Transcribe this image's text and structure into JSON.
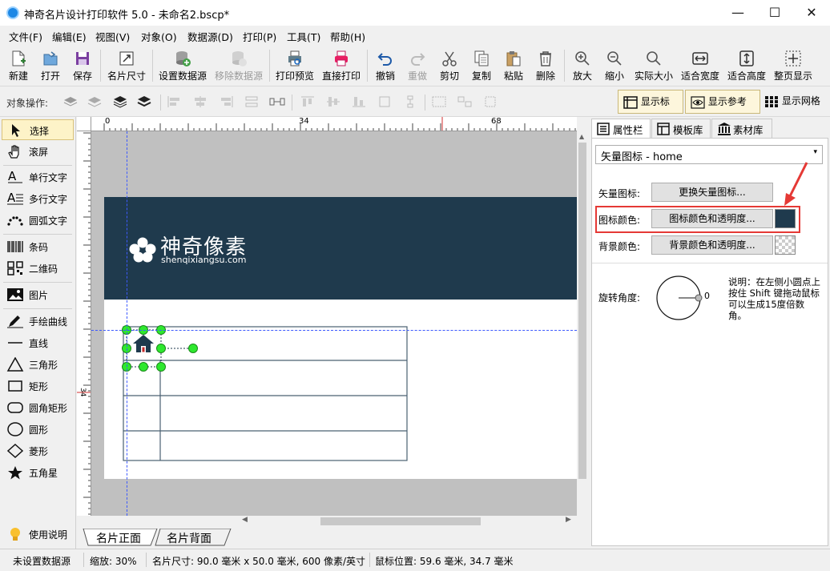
{
  "window": {
    "title": "神奇名片设计打印软件 5.0 - 未命名2.bscp*"
  },
  "menu": [
    "文件(F)",
    "编辑(E)",
    "视图(V)",
    "对象(O)",
    "数据源(D)",
    "打印(P)",
    "工具(T)",
    "帮助(H)"
  ],
  "toolbar": {
    "new": "新建",
    "open": "打开",
    "save": "保存",
    "card_size": "名片尺寸",
    "set_datasource": "设置数据源",
    "remove_datasource": "移除数据源",
    "print_preview": "打印预览",
    "direct_print": "直接打印",
    "undo": "撤销",
    "redo": "重做",
    "cut": "剪切",
    "copy": "复制",
    "paste": "粘贴",
    "delete": "删除",
    "zoom_in": "放大",
    "zoom_out": "缩小",
    "actual_size": "实际大小",
    "fit_width": "适合宽度",
    "fit_height": "适合高度",
    "fit_page": "整页显示"
  },
  "alignbar": {
    "label": "对象操作:",
    "show_ruler": "显示标尺",
    "show_guides": "显示参考线",
    "show_grid": "显示网格"
  },
  "tools": {
    "select": "选择",
    "pan": "滚屏",
    "single_text": "单行文字",
    "multi_text": "多行文字",
    "arc_text": "圆弧文字",
    "barcode": "条码",
    "qrcode": "二维码",
    "image": "图片",
    "freehand": "手绘曲线",
    "line": "直线",
    "triangle": "三角形",
    "rect": "矩形",
    "round_rect": "圆角矩形",
    "circle": "圆形",
    "diamond": "菱形",
    "star": "五角星",
    "help": "使用说明"
  },
  "ruler": {
    "top_marks": [
      "0",
      "34",
      "68"
    ],
    "left_mark": "34"
  },
  "card": {
    "brand_name": "神奇像素",
    "brand_url": "shenqixiangsu.com",
    "header_color": "#1f3a4d"
  },
  "sheet_tabs": [
    "名片正面",
    "名片背面"
  ],
  "right_panel": {
    "tabs": [
      "属性栏",
      "模板库",
      "素材库"
    ],
    "object_select": "矢量图标 - home",
    "vector_icon_label": "矢量图标:",
    "change_icon_btn": "更换矢量图标...",
    "icon_color_label": "图标颜色:",
    "icon_color_btn": "图标颜色和透明度...",
    "icon_color": "#1f3a4d",
    "bg_color_label": "背景颜色:",
    "bg_color_btn": "背景颜色和透明度...",
    "rotation_label": "旋转角度:",
    "rotation_value": "0",
    "rotation_hint": "说明：在左侧小圆点上按住 Shift 键拖动鼠标可以生成15度倍数角。"
  },
  "status": {
    "datasource": "未设置数据源",
    "zoom": "缩放: 30%",
    "card_size": "名片尺寸: 90.0 毫米 x 50.0 毫米, 600 像素/英寸",
    "mouse_pos": "鼠标位置: 59.6 毫米, 34.7 毫米"
  }
}
